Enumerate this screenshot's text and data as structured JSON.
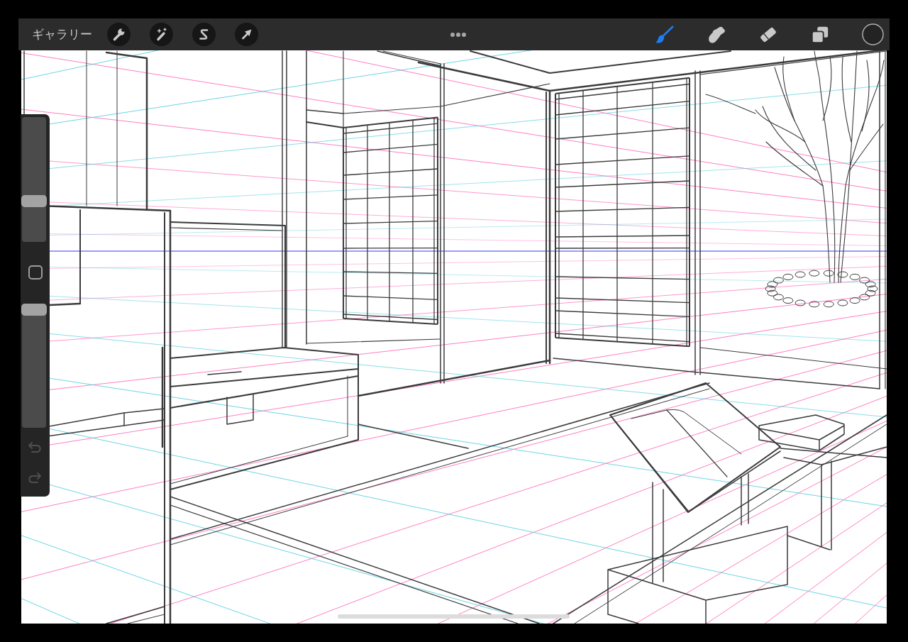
{
  "top_bar": {
    "gallery_button": "ギャラリー",
    "tools": [
      {
        "kind": "brush",
        "selected": true
      },
      {
        "kind": "smudge",
        "selected": false
      },
      {
        "kind": "eraser",
        "selected": false
      }
    ]
  },
  "sidebar": {
    "sliders": [
      {
        "level": 0.31
      },
      {
        "level": 1
      }
    ],
    "undo": {
      "disabled": true
    },
    "redo": {
      "disabled": true
    }
  }
}
